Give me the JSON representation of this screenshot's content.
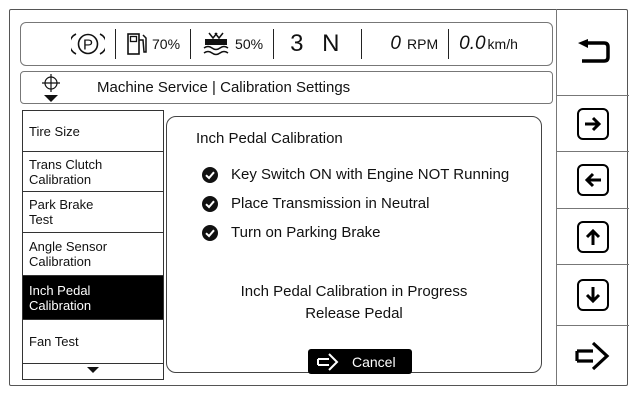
{
  "status_bar": {
    "park_symbol": "P",
    "fuel_percent": "70%",
    "def_percent": "50%",
    "gear": "3 N",
    "rpm_value": "0",
    "rpm_unit": "RPM",
    "speed_value": "0.0",
    "speed_unit": "km/h"
  },
  "breadcrumb": {
    "text": "Machine Service | Calibration Settings"
  },
  "sidebar": {
    "items": [
      {
        "label": "Tire Size"
      },
      {
        "label": "Trans Clutch\nCalibration"
      },
      {
        "label": "Park Brake\nTest"
      },
      {
        "label": "Angle Sensor\nCalibration"
      },
      {
        "label": "Inch Pedal\nCalibration",
        "active": true
      },
      {
        "label": "Fan Test"
      }
    ]
  },
  "panel": {
    "title": "Inch Pedal Calibration",
    "checklist": [
      "Key Switch ON with Engine NOT Running",
      "Place Transmission in Neutral",
      "Turn on Parking Brake"
    ],
    "progress_line1": "Inch Pedal Calibration in Progress",
    "progress_line2": "Release Pedal",
    "cancel_label": "Cancel"
  },
  "nav_buttons": {
    "icons": [
      "back-icon",
      "arrow-right-icon",
      "arrow-left-icon",
      "arrow-up-icon",
      "arrow-down-icon",
      "enter-icon"
    ]
  }
}
